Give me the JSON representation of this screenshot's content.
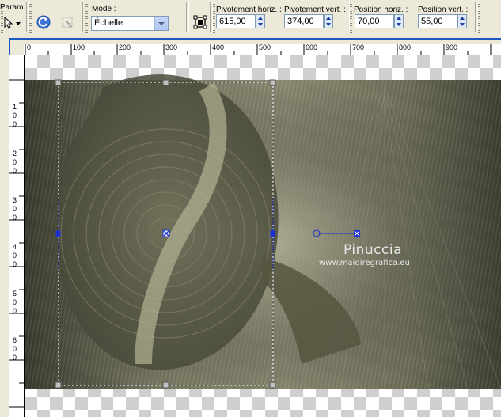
{
  "toolbar": {
    "presets_label": "Param. :",
    "mode_label": "Mode :",
    "mode_value": "Échelle",
    "pivot_x_label": "Pivotement horiz. :",
    "pivot_x_value": "615,00",
    "pivot_y_label": "Pivotement vert. :",
    "pivot_y_value": "374,00",
    "pos_x_label": "Position horiz. :",
    "pos_x_value": "70,00",
    "pos_y_label": "Position vert. :",
    "pos_y_value": "55,00"
  },
  "ruler_h": [
    "0",
    "100",
    "200",
    "300",
    "400",
    "500",
    "600",
    "700",
    "800",
    "900"
  ],
  "ruler_v": [
    "1 0 0",
    "2 0 0",
    "3 0 0",
    "4 0 0",
    "5 0 0",
    "6 0 0"
  ],
  "watermark": {
    "title": "Pinuccia",
    "url": "www.maidiregrafica.eu"
  },
  "colors": {
    "frame_blue": "#1a57c4",
    "handle_blue": "#1a2fcf"
  }
}
